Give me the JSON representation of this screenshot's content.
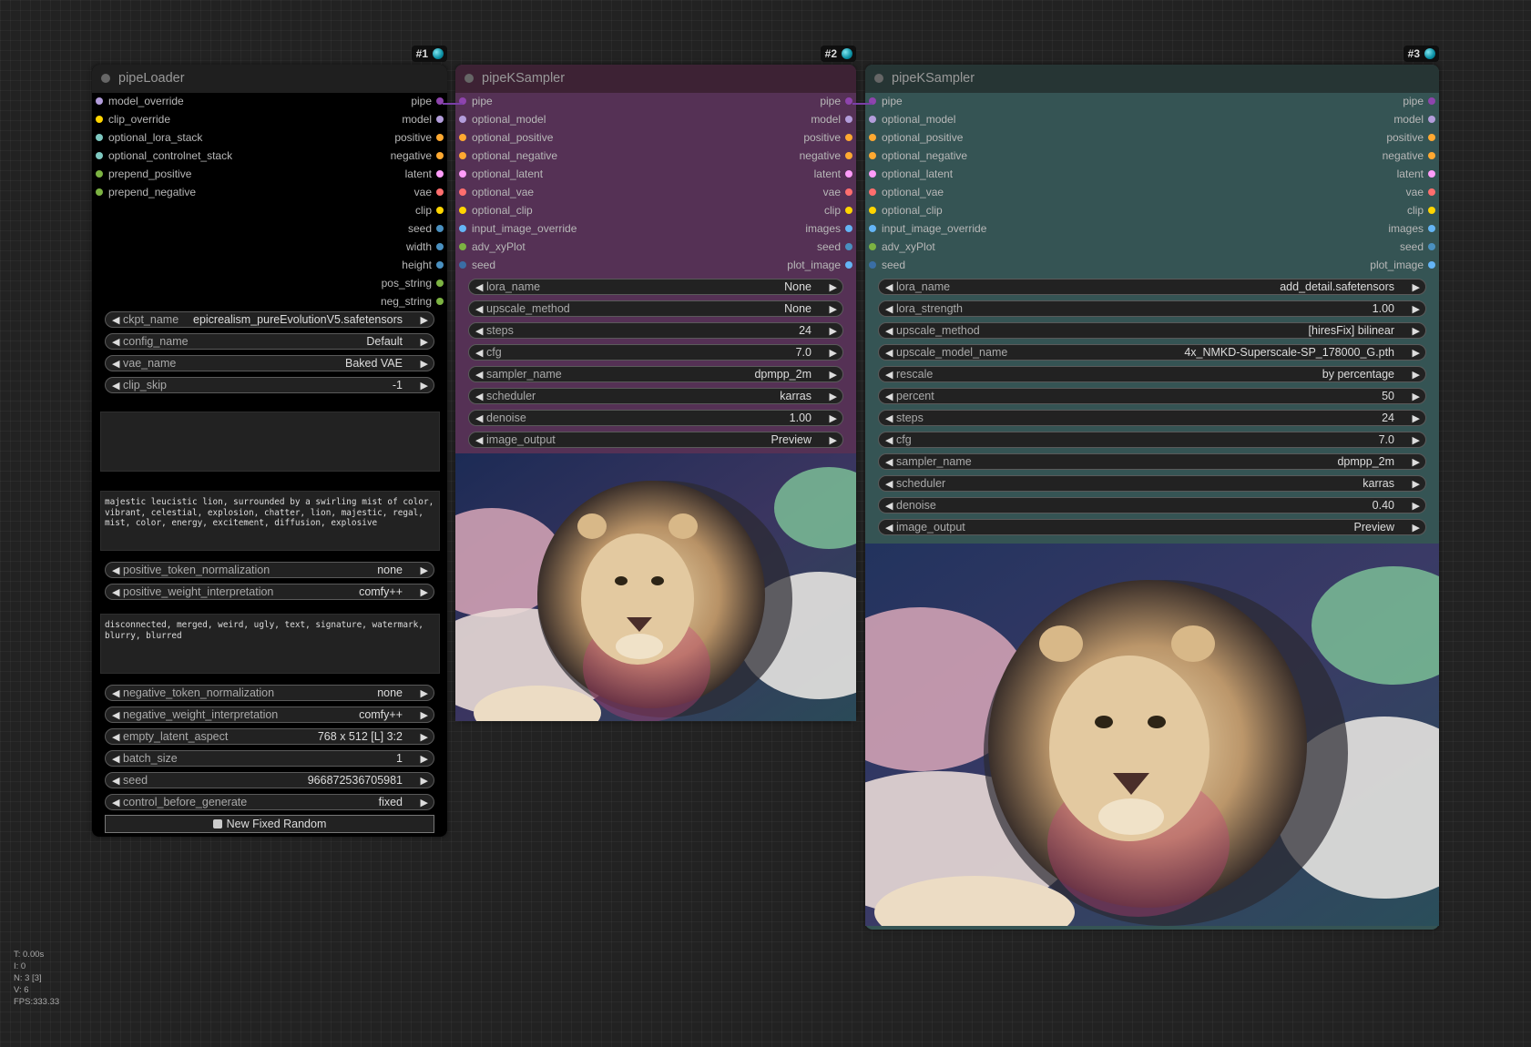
{
  "nodes": [
    {
      "id_label": "#1",
      "title": "pipeLoader",
      "inputs": [
        {
          "label": "model_override",
          "color": "#b39ddb"
        },
        {
          "label": "clip_override",
          "color": "#ffd500"
        },
        {
          "label": "optional_lora_stack",
          "color": "#7ec8c0"
        },
        {
          "label": "optional_controlnet_stack",
          "color": "#7ec8c0"
        },
        {
          "label": "prepend_positive",
          "color": "#7cb342"
        },
        {
          "label": "prepend_negative",
          "color": "#7cb342"
        }
      ],
      "outputs": [
        {
          "label": "pipe",
          "color": "#8e44ad"
        },
        {
          "label": "model",
          "color": "#b39ddb"
        },
        {
          "label": "positive",
          "color": "#ffa931"
        },
        {
          "label": "negative",
          "color": "#ffa931"
        },
        {
          "label": "latent",
          "color": "#ff9cf9"
        },
        {
          "label": "vae",
          "color": "#ff6e6e"
        },
        {
          "label": "clip",
          "color": "#ffd500"
        },
        {
          "label": "seed",
          "color": "#4a90c0"
        },
        {
          "label": "width",
          "color": "#4a90c0"
        },
        {
          "label": "height",
          "color": "#4a90c0"
        },
        {
          "label": "pos_string",
          "color": "#7cb342"
        },
        {
          "label": "neg_string",
          "color": "#7cb342"
        }
      ],
      "widgets_top": [
        {
          "label": "ckpt_name",
          "value": "epicrealism_pureEvolutionV5.safetensors"
        },
        {
          "label": "config_name",
          "value": "Default"
        },
        {
          "label": "vae_name",
          "value": "Baked VAE"
        },
        {
          "label": "clip_skip",
          "value": "-1"
        }
      ],
      "positive_text": "majestic leucistic lion, surrounded by a swirling mist of color, vibrant, celestial, explosion, chatter, lion, majestic, regal, mist, color, energy, excitement, diffusion, explosive",
      "widgets_mid": [
        {
          "label": "positive_token_normalization",
          "value": "none"
        },
        {
          "label": "positive_weight_interpretation",
          "value": "comfy++"
        }
      ],
      "negative_text": "disconnected, merged, weird, ugly, text, signature, watermark, blurry, blurred",
      "widgets_bottom": [
        {
          "label": "negative_token_normalization",
          "value": "none"
        },
        {
          "label": "negative_weight_interpretation",
          "value": "comfy++"
        },
        {
          "label": "empty_latent_aspect",
          "value": "768 x 512 [L] 3:2"
        },
        {
          "label": "batch_size",
          "value": "1"
        },
        {
          "label": "seed",
          "value": "966872536705981"
        },
        {
          "label": "control_before_generate",
          "value": "fixed"
        }
      ],
      "button_label": "New Fixed Random",
      "button_icon": "dice-icon"
    },
    {
      "id_label": "#2",
      "title": "pipeKSampler",
      "inputs": [
        {
          "label": "pipe",
          "color": "#8e44ad"
        },
        {
          "label": "optional_model",
          "color": "#b39ddb"
        },
        {
          "label": "optional_positive",
          "color": "#ffa931"
        },
        {
          "label": "optional_negative",
          "color": "#ffa931"
        },
        {
          "label": "optional_latent",
          "color": "#ff9cf9"
        },
        {
          "label": "optional_vae",
          "color": "#ff6e6e"
        },
        {
          "label": "optional_clip",
          "color": "#ffd500"
        },
        {
          "label": "input_image_override",
          "color": "#64b5f6"
        },
        {
          "label": "adv_xyPlot",
          "color": "#7cb342"
        },
        {
          "label": "seed",
          "color": "#3a6ea5"
        }
      ],
      "outputs": [
        {
          "label": "pipe",
          "color": "#8e44ad"
        },
        {
          "label": "model",
          "color": "#b39ddb"
        },
        {
          "label": "positive",
          "color": "#ffa931"
        },
        {
          "label": "negative",
          "color": "#ffa931"
        },
        {
          "label": "latent",
          "color": "#ff9cf9"
        },
        {
          "label": "vae",
          "color": "#ff6e6e"
        },
        {
          "label": "clip",
          "color": "#ffd500"
        },
        {
          "label": "images",
          "color": "#64b5f6"
        },
        {
          "label": "seed",
          "color": "#4a90c0"
        },
        {
          "label": "plot_image",
          "color": "#64b5f6"
        }
      ],
      "widgets": [
        {
          "label": "lora_name",
          "value": "None"
        },
        {
          "label": "upscale_method",
          "value": "None"
        },
        {
          "label": "steps",
          "value": "24"
        },
        {
          "label": "cfg",
          "value": "7.0"
        },
        {
          "label": "sampler_name",
          "value": "dpmpp_2m"
        },
        {
          "label": "scheduler",
          "value": "karras"
        },
        {
          "label": "denoise",
          "value": "1.00"
        },
        {
          "label": "image_output",
          "value": "Preview"
        }
      ]
    },
    {
      "id_label": "#3",
      "title": "pipeKSampler",
      "inputs": [
        {
          "label": "pipe",
          "color": "#8e44ad"
        },
        {
          "label": "optional_model",
          "color": "#b39ddb"
        },
        {
          "label": "optional_positive",
          "color": "#ffa931"
        },
        {
          "label": "optional_negative",
          "color": "#ffa931"
        },
        {
          "label": "optional_latent",
          "color": "#ff9cf9"
        },
        {
          "label": "optional_vae",
          "color": "#ff6e6e"
        },
        {
          "label": "optional_clip",
          "color": "#ffd500"
        },
        {
          "label": "input_image_override",
          "color": "#64b5f6"
        },
        {
          "label": "adv_xyPlot",
          "color": "#7cb342"
        },
        {
          "label": "seed",
          "color": "#3a6ea5"
        }
      ],
      "outputs": [
        {
          "label": "pipe",
          "color": "#8e44ad"
        },
        {
          "label": "model",
          "color": "#b39ddb"
        },
        {
          "label": "positive",
          "color": "#ffa931"
        },
        {
          "label": "negative",
          "color": "#ffa931"
        },
        {
          "label": "latent",
          "color": "#ff9cf9"
        },
        {
          "label": "vae",
          "color": "#ff6e6e"
        },
        {
          "label": "clip",
          "color": "#ffd500"
        },
        {
          "label": "images",
          "color": "#64b5f6"
        },
        {
          "label": "seed",
          "color": "#4a90c0"
        },
        {
          "label": "plot_image",
          "color": "#64b5f6"
        }
      ],
      "widgets": [
        {
          "label": "lora_name",
          "value": "add_detail.safetensors"
        },
        {
          "label": "lora_strength",
          "value": "1.00"
        },
        {
          "label": "upscale_method",
          "value": "[hiresFix] bilinear"
        },
        {
          "label": "upscale_model_name",
          "value": "4x_NMKD-Superscale-SP_178000_G.pth"
        },
        {
          "label": "rescale",
          "value": "by percentage"
        },
        {
          "label": "percent",
          "value": "50"
        },
        {
          "label": "steps",
          "value": "24"
        },
        {
          "label": "cfg",
          "value": "7.0"
        },
        {
          "label": "sampler_name",
          "value": "dpmpp_2m"
        },
        {
          "label": "scheduler",
          "value": "karras"
        },
        {
          "label": "denoise",
          "value": "0.40"
        },
        {
          "label": "image_output",
          "value": "Preview"
        }
      ]
    }
  ],
  "stats": {
    "t": "T: 0.00s",
    "i": "I: 0",
    "n": "N: 3 [3]",
    "v": "V: 6",
    "fps": "FPS:333.33"
  },
  "colors": {
    "loader_body": "#000000",
    "sampler2_header": "#3d2234",
    "sampler2_body": "#553155",
    "sampler3_header": "#263534",
    "sampler3_body": "#355454",
    "link": "#7a3fa8"
  }
}
